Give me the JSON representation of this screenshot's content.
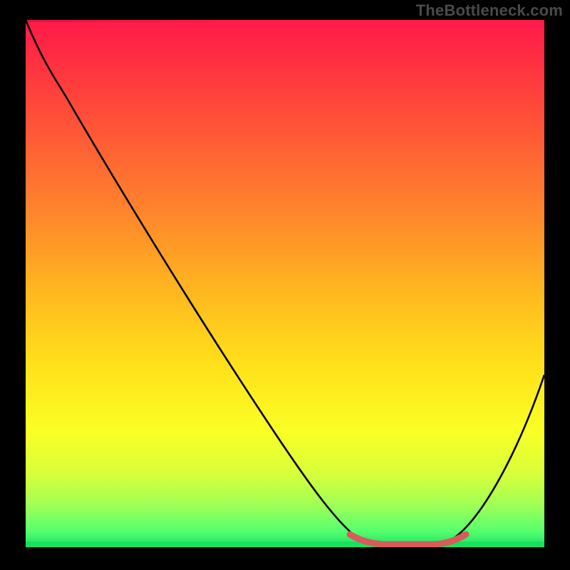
{
  "watermark": "TheBottleneck.com",
  "colors": {
    "stroke": "#000000",
    "highlight": "#d85b5b",
    "bg_top": "#ff1a4a",
    "bg_bottom": "#18e060"
  },
  "chart_data": {
    "type": "line",
    "title": "",
    "xlabel": "",
    "ylabel": "",
    "xlim": [
      0,
      100
    ],
    "ylim": [
      0,
      100
    ],
    "grid": false,
    "legend": false,
    "series": [
      {
        "name": "curve",
        "x": [
          0,
          5,
          10,
          18,
          30,
          42,
          55,
          62,
          66,
          72,
          78,
          84,
          90,
          95,
          100
        ],
        "y": [
          100,
          95,
          88,
          77,
          60,
          42,
          22,
          10,
          3,
          0.5,
          0.5,
          3,
          12,
          22,
          35
        ]
      }
    ],
    "highlight_region": {
      "x_start": 62,
      "x_end": 84,
      "y": 0.5
    },
    "background_gradient": {
      "stops": [
        {
          "pos": 0,
          "color": "#ff1a4a"
        },
        {
          "pos": 0.5,
          "color": "#ffd21f"
        },
        {
          "pos": 0.95,
          "color": "#9fff55"
        },
        {
          "pos": 1,
          "color": "#18e060"
        }
      ]
    }
  }
}
